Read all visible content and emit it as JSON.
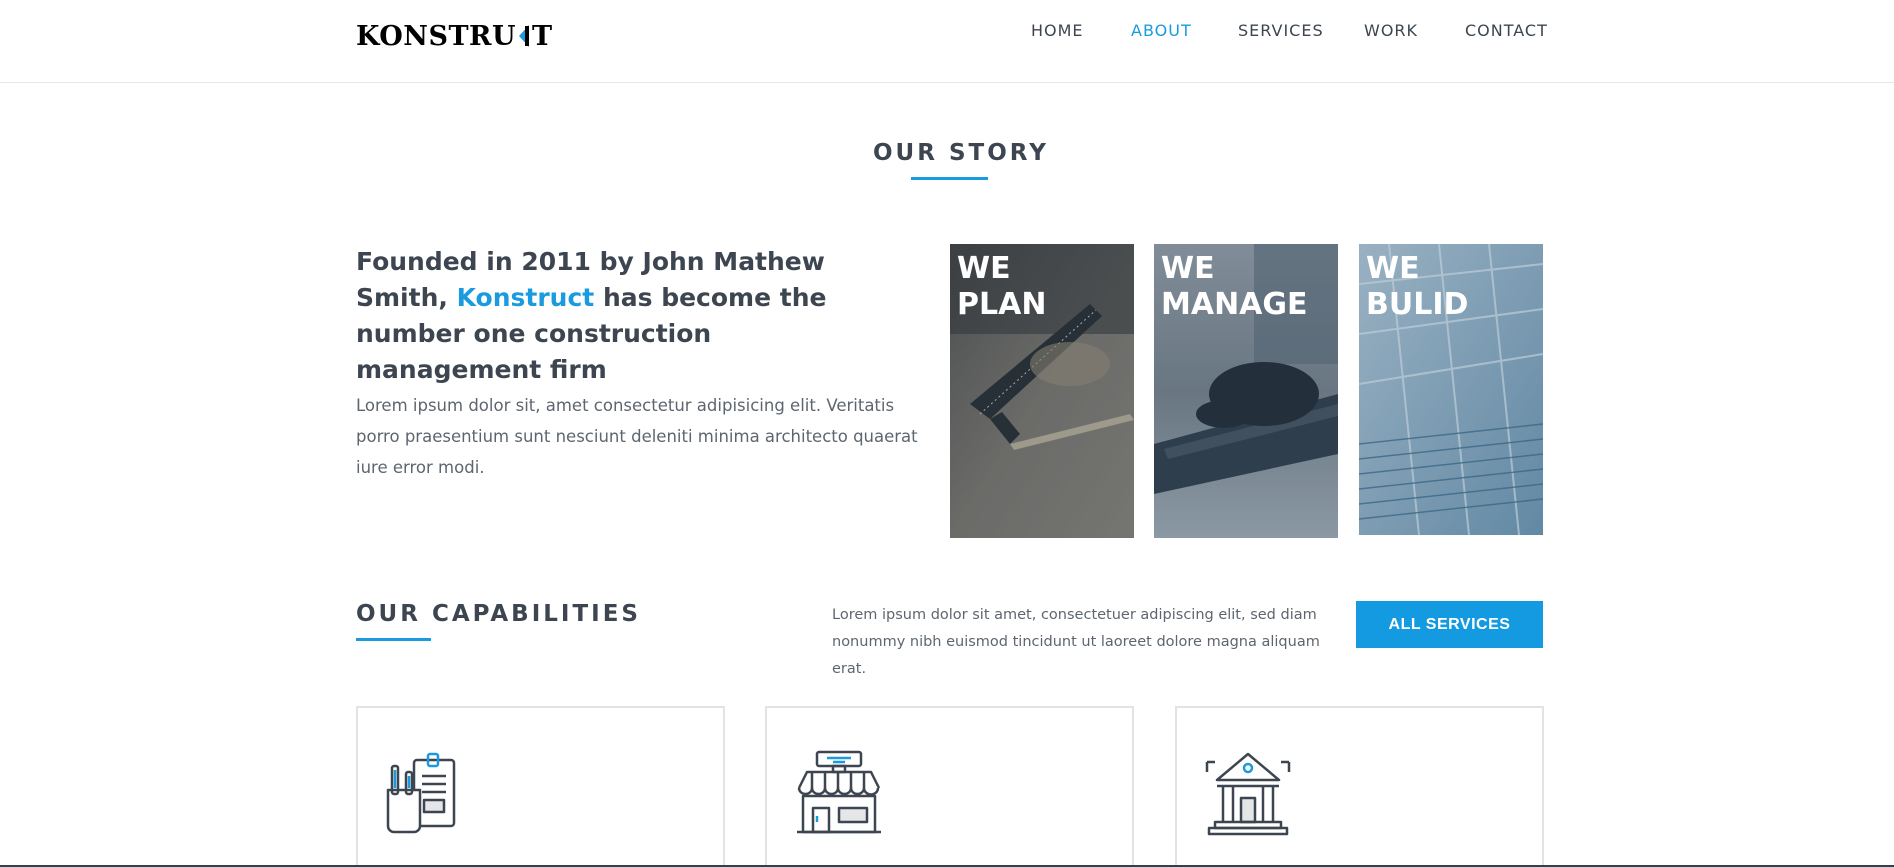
{
  "brand": {
    "logo_text_left": "KONSTRU",
    "logo_text_right": "T",
    "accent": "#1a9be0"
  },
  "nav": {
    "items": [
      {
        "label": "HOME",
        "active": false
      },
      {
        "label": "ABOUT",
        "active": true
      },
      {
        "label": "SERVICES",
        "active": false
      },
      {
        "label": "WORK",
        "active": false
      },
      {
        "label": "CONTACT",
        "active": false
      }
    ]
  },
  "story": {
    "title": "OUR STORY",
    "headline_part1": "Founded in 2011 by John Mathew Smith,",
    "headline_highlight": "Konstruct",
    "headline_part2": "has become the number one construction management firm",
    "body": "Lorem ipsum dolor sit, amet consectetur adipisicing elit. Veritatis porro praesentium sunt nesciunt deleniti minima architecto quaerat iure error modi.",
    "cards": [
      {
        "label": "WE\nPLAN",
        "image": "tools-on-table-photo"
      },
      {
        "label": "WE\nMANAGE",
        "image": "hands-on-laptop-photo"
      },
      {
        "label": "WE\nBULID",
        "image": "building-structure-photo"
      }
    ]
  },
  "capabilities": {
    "title": "OUR CAPABILITIES",
    "description": "Lorem ipsum dolor sit amet, consectetuer adipiscing elit, sed diam nonummy nibh euismod tincidunt ut laoreet dolore magna aliquam erat.",
    "button_label": "ALL SERVICES",
    "boxes": [
      {
        "icon": "documents-icon"
      },
      {
        "icon": "shop-icon"
      },
      {
        "icon": "bank-building-icon"
      }
    ]
  }
}
